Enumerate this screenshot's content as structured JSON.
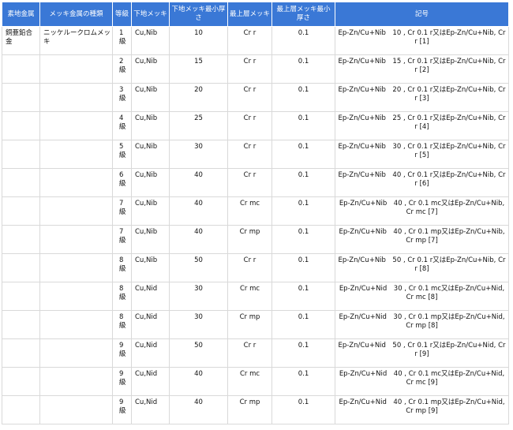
{
  "headers": [
    "素地金属",
    "メッキ金属の種類",
    "等級",
    "下地メッキ",
    "下地メッキ最小厚さ",
    "最上層メッキ",
    "最上層メッキ最小厚さ",
    "記号"
  ],
  "rows": [
    {
      "base": "銅亜鉛合金",
      "plating": "ニッケルークロムメッキ",
      "grade": "1級",
      "under": "Cu,Nib",
      "under_thk": "10",
      "top": "Cr r",
      "top_thk": "0.1",
      "code": "Ep-Zn/Cu+Nib　10 , Cr 0.1 r又はEp-Zn/Cu+Nib, Cr r [1]"
    },
    {
      "base": "",
      "plating": "",
      "grade": "2級",
      "under": "Cu,Nib",
      "under_thk": "15",
      "top": "Cr r",
      "top_thk": "0.1",
      "code": "Ep-Zn/Cu+Nib　15 , Cr 0.1 r又はEp-Zn/Cu+Nib, Cr r [2]"
    },
    {
      "base": "",
      "plating": "",
      "grade": "3級",
      "under": "Cu,Nib",
      "under_thk": "20",
      "top": "Cr r",
      "top_thk": "0.1",
      "code": "Ep-Zn/Cu+Nib　20 , Cr 0.1 r又はEp-Zn/Cu+Nib, Cr r [3]"
    },
    {
      "base": "",
      "plating": "",
      "grade": "4級",
      "under": "Cu,Nib",
      "under_thk": "25",
      "top": "Cr r",
      "top_thk": "0.1",
      "code": "Ep-Zn/Cu+Nib　25 , Cr 0.1 r又はEp-Zn/Cu+Nib, Cr r [4]"
    },
    {
      "base": "",
      "plating": "",
      "grade": "5級",
      "under": "Cu,Nib",
      "under_thk": "30",
      "top": "Cr r",
      "top_thk": "0.1",
      "code": "Ep-Zn/Cu+Nib　30 , Cr 0.1 r又はEp-Zn/Cu+Nib, Cr r [5]"
    },
    {
      "base": "",
      "plating": "",
      "grade": "6級",
      "under": "Cu,Nib",
      "under_thk": "40",
      "top": "Cr r",
      "top_thk": "0.1",
      "code": "Ep-Zn/Cu+Nib　40 , Cr 0.1 r又はEp-Zn/Cu+Nib, Cr r [6]"
    },
    {
      "base": "",
      "plating": "",
      "grade": "7級",
      "under": "Cu,Nib",
      "under_thk": "40",
      "top": "Cr mc",
      "top_thk": "0.1",
      "code": "Ep-Zn/Cu+Nib　40 , Cr 0.1 mc又はEp-Zn/Cu+Nib, Cr mc [7]"
    },
    {
      "base": "",
      "plating": "",
      "grade": "7級",
      "under": "Cu,Nib",
      "under_thk": "40",
      "top": "Cr mp",
      "top_thk": "0.1",
      "code": "Ep-Zn/Cu+Nib　40 , Cr 0.1 mp又はEp-Zn/Cu+Nib, Cr mp [7]"
    },
    {
      "base": "",
      "plating": "",
      "grade": "8級",
      "under": "Cu,Nib",
      "under_thk": "50",
      "top": "Cr r",
      "top_thk": "0.1",
      "code": "Ep-Zn/Cu+Nib　50 , Cr 0.1 r又はEp-Zn/Cu+Nib, Cr r [8]"
    },
    {
      "base": "",
      "plating": "",
      "grade": "8級",
      "under": "Cu,Nid",
      "under_thk": "30",
      "top": "Cr mc",
      "top_thk": "0.1",
      "code": "Ep-Zn/Cu+Nid　30 , Cr 0.1 mc又はEp-Zn/Cu+Nid, Cr mc [8]"
    },
    {
      "base": "",
      "plating": "",
      "grade": "8級",
      "under": "Cu,Nid",
      "under_thk": "30",
      "top": "Cr mp",
      "top_thk": "0.1",
      "code": "Ep-Zn/Cu+Nid　30 , Cr 0.1 mp又はEp-Zn/Cu+Nid, Cr mp [8]"
    },
    {
      "base": "",
      "plating": "",
      "grade": "9級",
      "under": "Cu,Nid",
      "under_thk": "50",
      "top": "Cr r",
      "top_thk": "0.1",
      "code": "Ep-Zn/Cu+Nid　50 , Cr 0.1 r又はEp-Zn/Cu+Nid, Cr r [9]"
    },
    {
      "base": "",
      "plating": "",
      "grade": "9級",
      "under": "Cu,Nid",
      "under_thk": "40",
      "top": "Cr mc",
      "top_thk": "0.1",
      "code": "Ep-Zn/Cu+Nid　40 , Cr 0.1 mc又はEp-Zn/Cu+Nid, Cr mc [9]"
    },
    {
      "base": "",
      "plating": "",
      "grade": "9級",
      "under": "Cu,Nid",
      "under_thk": "40",
      "top": "Cr mp",
      "top_thk": "0.1",
      "code": "Ep-Zn/Cu+Nid　40 , Cr 0.1 mp又はEp-Zn/Cu+Nid, Cr mp [9]"
    }
  ]
}
